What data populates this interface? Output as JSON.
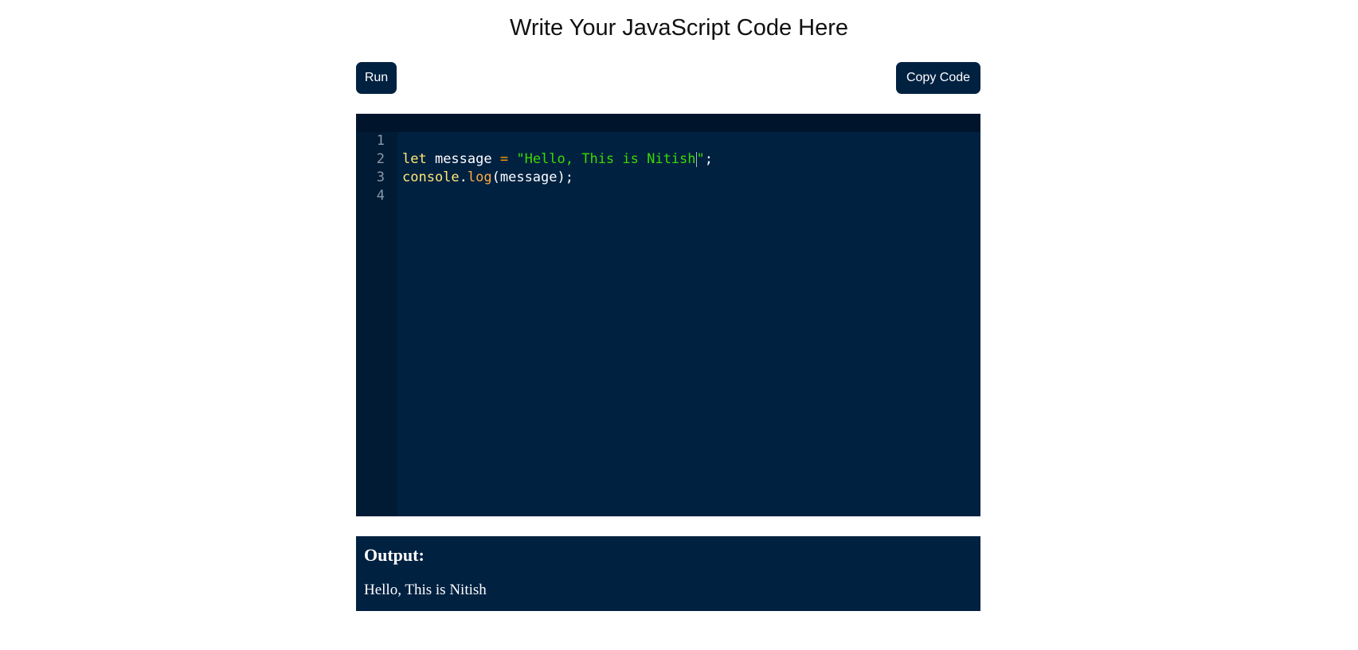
{
  "page": {
    "title": "Write Your JavaScript Code Here"
  },
  "toolbar": {
    "run_label": "Run",
    "copy_label": "Copy Code"
  },
  "editor": {
    "line_numbers": [
      "1",
      "2",
      "3",
      "4"
    ],
    "lines": [
      {
        "tokens": [
          {
            "text": "let",
            "kind": "keyword"
          },
          {
            "text": " message ",
            "kind": "ident"
          },
          {
            "text": "=",
            "kind": "op"
          },
          {
            "text": " ",
            "kind": "plain"
          },
          {
            "text": "\"Hello, This is Nitish",
            "kind": "string"
          },
          {
            "text": "\"",
            "kind": "string"
          },
          {
            "text": ";",
            "kind": "plain"
          }
        ]
      },
      {
        "tokens": [
          {
            "text": "console",
            "kind": "keyword"
          },
          {
            "text": ".",
            "kind": "plain"
          },
          {
            "text": "log",
            "kind": "prop"
          },
          {
            "text": "(message);",
            "kind": "plain"
          }
        ]
      },
      {
        "tokens": []
      },
      {
        "tokens": []
      }
    ],
    "active_line": 1,
    "colors": {
      "background": "#012141",
      "gutter": "#011b35",
      "active_line": "#00152c",
      "keyword": "#ffe873",
      "operator": "#ff9d00",
      "string": "#3ad900",
      "property": "#ffaa44",
      "line_number": "#8d99a6"
    }
  },
  "output": {
    "heading": "Output:",
    "text": "Hello, This is Nitish"
  }
}
